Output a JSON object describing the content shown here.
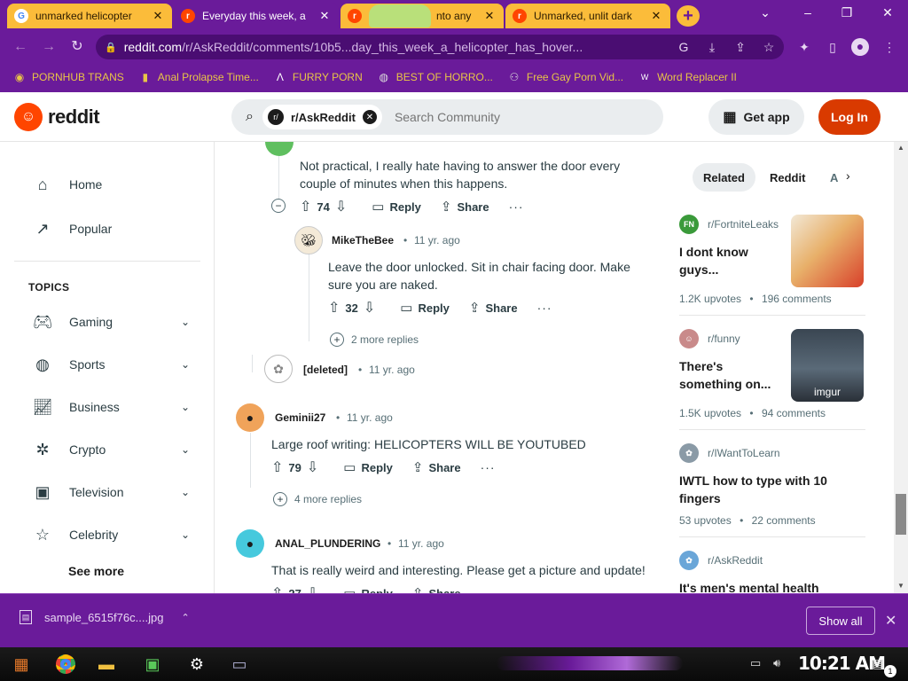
{
  "browser": {
    "tabs": [
      {
        "title": "unmarked helicopter",
        "active": false,
        "icon": "G",
        "icon_color": "#4285f4"
      },
      {
        "title": "Everyday this week, a",
        "active": true,
        "icon": "r",
        "icon_color": "#ff4500"
      },
      {
        "title": "nto any",
        "active": false,
        "icon": "r",
        "icon_color": "#ff4500"
      },
      {
        "title": "Unmarked, unlit dark",
        "active": false,
        "icon": "r",
        "icon_color": "#ff4500"
      }
    ],
    "url_host": "reddit.com",
    "url_path": "/r/AskReddit/comments/10b5...day_this_week_a_helicopter_has_hover...",
    "bookmarks": [
      {
        "label": "PORNHUB TRANS",
        "icon": "◉"
      },
      {
        "label": "Anal Prolapse Time...",
        "icon": "▮"
      },
      {
        "label": "FURRY PORN",
        "icon": "Λ"
      },
      {
        "label": "BEST OF HORRO...",
        "icon": "◍"
      },
      {
        "label": "Free Gay Porn Vid...",
        "icon": "⚇"
      },
      {
        "label": "Word Replacer II",
        "icon": "W"
      }
    ]
  },
  "header": {
    "wordmark": "reddit",
    "subreddit_chip": "r/AskReddit",
    "search_placeholder": "Search Community",
    "get_app": "Get app",
    "login": "Log In"
  },
  "leftnav": {
    "home": "Home",
    "popular": "Popular",
    "topics_label": "TOPICS",
    "topics": [
      "Gaming",
      "Sports",
      "Business",
      "Crypto",
      "Television",
      "Celebrity"
    ],
    "see_more": "See more"
  },
  "comments": {
    "c1": {
      "body": "Not practical, I really hate having to answer the door every couple of minutes when this happens.",
      "votes": "74"
    },
    "c2": {
      "author": "MikeTheBee",
      "time": "11 yr. ago",
      "body": "Leave the door unlocked. Sit in chair facing door. Make sure you are naked.",
      "votes": "32",
      "more_replies": "2 more replies"
    },
    "c3": {
      "author": "[deleted]",
      "time": "11 yr. ago"
    },
    "c4": {
      "author": "Geminii27",
      "time": "11 yr. ago",
      "body": "Large roof writing: HELICOPTERS WILL BE YOUTUBED",
      "votes": "79",
      "more_replies": "4 more replies"
    },
    "c5": {
      "author": "ANAL_PLUNDERING",
      "time": "11 yr. ago",
      "body": "That is really weird and interesting. Please get a picture and update!",
      "votes": "27"
    },
    "reply_label": "Reply",
    "share_label": "Share",
    "dot": "•"
  },
  "rightrail": {
    "tabs": [
      "Related",
      "Reddit",
      "A"
    ],
    "posts": [
      {
        "sub": "r/FortniteLeaks",
        "title_l1": "I dont know",
        "title_l2": "guys...",
        "upvotes": "1.2K upvotes",
        "comments": "196 comments"
      },
      {
        "sub": "r/funny",
        "title_l1": "There's",
        "title_l2": "something on...",
        "upvotes": "1.5K upvotes",
        "comments": "94 comments",
        "thumb_label": "imgur"
      },
      {
        "sub": "r/IWantToLearn",
        "title_l1": "IWTL how to type with 10",
        "title_l2": "fingers",
        "upvotes": "53 upvotes",
        "comments": "22 comments"
      },
      {
        "sub": "r/AskReddit",
        "title_l1": "It's men's mental health",
        "title_l2": ""
      }
    ]
  },
  "download": {
    "filename": "sample_6515f76c....jpg",
    "show_all": "Show all"
  },
  "taskbar": {
    "clock": "10:21 AM",
    "notif_count": "1"
  },
  "colors": {
    "browser_purple": "#6a1b9a",
    "tab_inactive": "#fbbc3a",
    "reddit_orange": "#ff4500",
    "login_orange": "#d93a00",
    "bookmark_yellow": "#e8c547"
  }
}
